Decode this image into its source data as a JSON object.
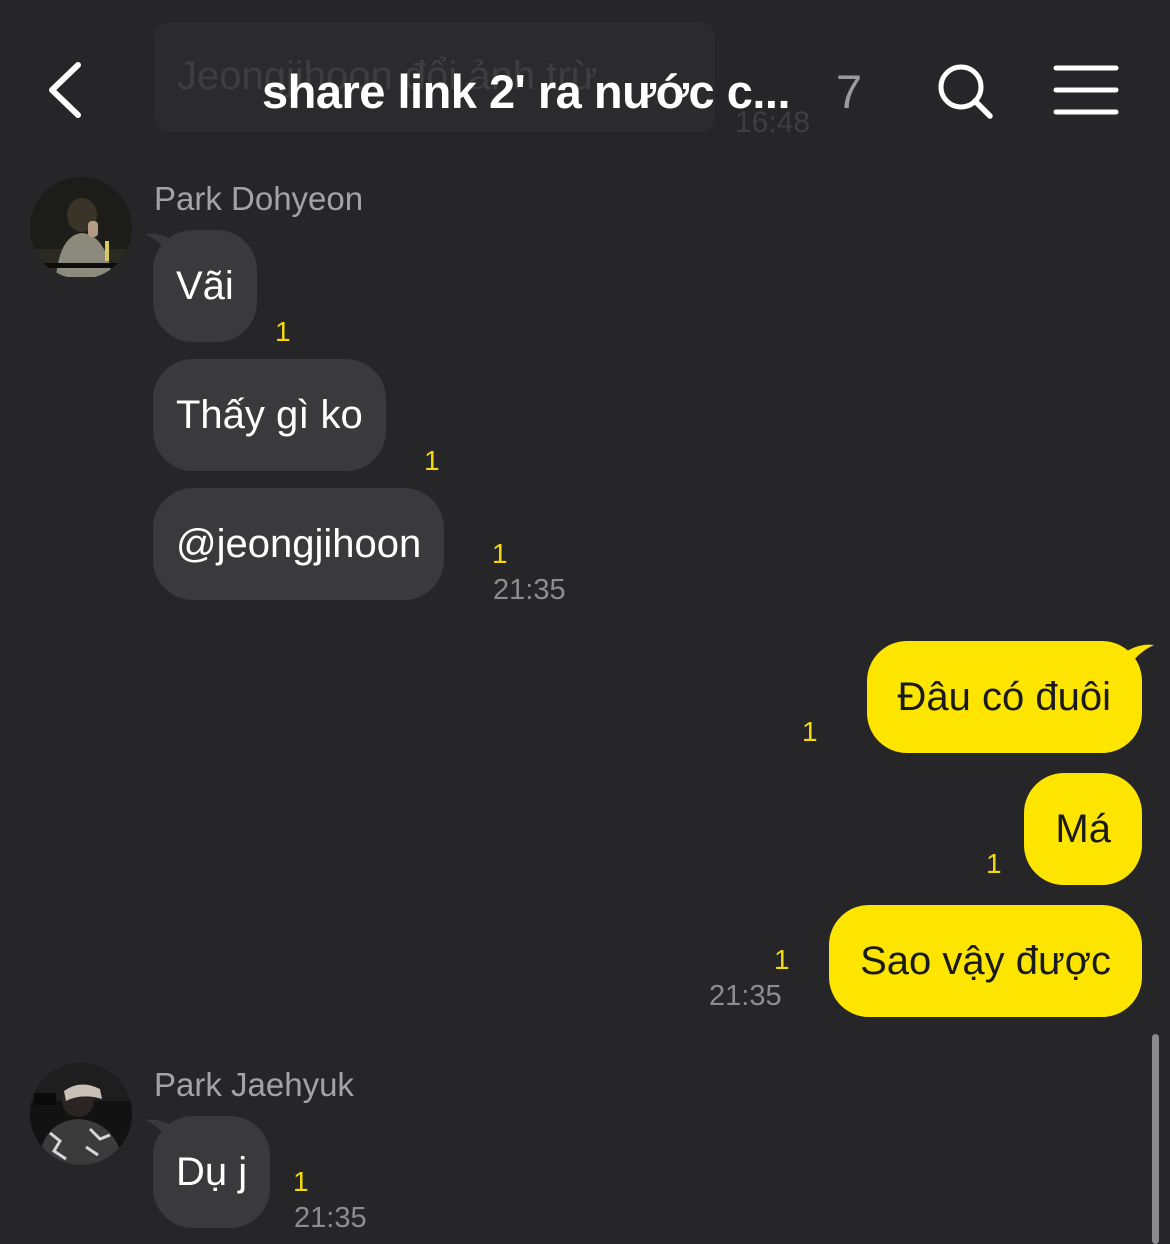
{
  "header": {
    "title": "share link 2' ra nước c...",
    "member_count": "7",
    "back_icon": "chevron-left-icon",
    "search_icon": "search-icon",
    "menu_icon": "hamburger-menu-icon"
  },
  "notice": {
    "text": "Jeongjihoon đổi ảnh trừ",
    "time": "16:48"
  },
  "messages": [
    {
      "sender": "Park Dohyeon",
      "bubbles": [
        {
          "text": "Vãi",
          "unread": "1"
        },
        {
          "text": "Thấy gì ko",
          "unread": "1"
        },
        {
          "text": "@jeongjihoon",
          "unread": "1",
          "time": "21:35"
        }
      ]
    },
    {
      "sender": "me",
      "bubbles": [
        {
          "text": "Đâu có đuôi",
          "unread": "1"
        },
        {
          "text": "Má",
          "unread": "1"
        },
        {
          "text": "Sao vậy được",
          "unread": "1",
          "time": "21:35"
        }
      ]
    },
    {
      "sender": "Park Jaehyuk",
      "bubbles": [
        {
          "text": "Dụ j",
          "unread": "1",
          "time": "21:35"
        }
      ]
    }
  ],
  "colors": {
    "background": "#262628",
    "incoming_bubble": "#3a3a3c",
    "outgoing_bubble": "#fee500",
    "unread_count": "#f5d90a"
  }
}
